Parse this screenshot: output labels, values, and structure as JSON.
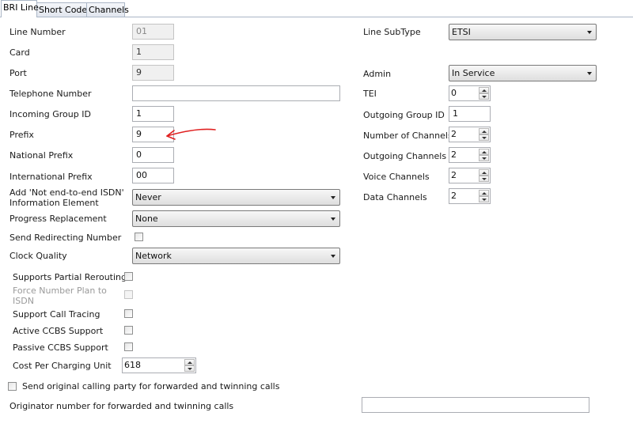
{
  "tabs": [
    "BRI Line",
    "Short Codes",
    "Channels"
  ],
  "left": {
    "line_number": {
      "label": "Line Number",
      "value": "01"
    },
    "card": {
      "label": "Card",
      "value": "1"
    },
    "port": {
      "label": "Port",
      "value": "9"
    },
    "telephone_number": {
      "label": "Telephone Number",
      "value": ""
    },
    "incoming_group_id": {
      "label": "Incoming Group ID",
      "value": "1"
    },
    "prefix": {
      "label": "Prefix",
      "value": "9"
    },
    "national_prefix": {
      "label": "National Prefix",
      "value": "0"
    },
    "international_prefix": {
      "label": "International Prefix",
      "value": "00"
    },
    "not_end_to_end": {
      "label_line1": "Add 'Not end-to-end ISDN'",
      "label_line2": "Information Element",
      "value": "Never"
    },
    "progress_replacement": {
      "label": "Progress Replacement",
      "value": "None"
    },
    "send_redirecting_number": {
      "label": "Send Redirecting Number"
    },
    "clock_quality": {
      "label": "Clock Quality",
      "value": "Network"
    },
    "supports_partial_rerouting": {
      "label": "Supports Partial Rerouting"
    },
    "force_number_plan": {
      "label_line1": "Force Number Plan to",
      "label_line2": "ISDN"
    },
    "support_call_tracing": {
      "label": "Support Call Tracing"
    },
    "active_ccbs": {
      "label": "Active CCBS Support"
    },
    "passive_ccbs": {
      "label": "Passive CCBS Support"
    },
    "cost_per_charging_unit": {
      "label": "Cost Per Charging Unit",
      "value": "618"
    }
  },
  "right": {
    "line_subtype": {
      "label": "Line SubType",
      "value": "ETSI"
    },
    "admin": {
      "label": "Admin",
      "value": "In Service"
    },
    "tei": {
      "label": "TEI",
      "value": "0"
    },
    "outgoing_group_id": {
      "label": "Outgoing Group ID",
      "value": "1"
    },
    "number_of_channels": {
      "label": "Number of Channels",
      "value": "2"
    },
    "outgoing_channels": {
      "label": "Outgoing Channels",
      "value": "2"
    },
    "voice_channels": {
      "label": "Voice Channels",
      "value": "2"
    },
    "data_channels": {
      "label": "Data Channels",
      "value": "2"
    }
  },
  "bottom": {
    "send_original_calling_party": {
      "label": "Send original calling party for forwarded and twinning calls"
    },
    "originator_number": {
      "label": "Originator number for forwarded and twinning calls",
      "value": ""
    }
  },
  "colors": {
    "annotation_arrow": "#e02020"
  }
}
